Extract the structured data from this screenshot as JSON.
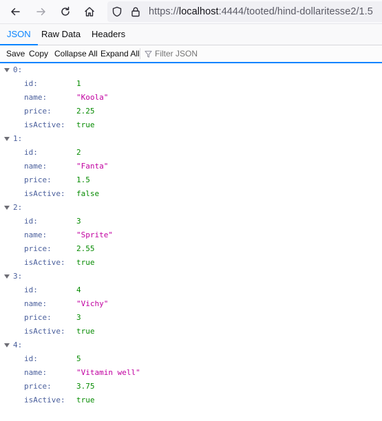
{
  "browser": {
    "url_prefix": "https://",
    "url_host": "localhost",
    "url_rest": ":4444/tooted/hind-dollaritesse2/1.5"
  },
  "tabs": [
    {
      "label": "JSON",
      "active": true
    },
    {
      "label": "Raw Data",
      "active": false
    },
    {
      "label": "Headers",
      "active": false
    }
  ],
  "toolbar": {
    "save": "Save",
    "copy": "Copy",
    "collapse_all": "Collapse All",
    "expand_all": "Expand All",
    "filter_placeholder": "Filter JSON"
  },
  "items": [
    {
      "index": "0:",
      "fields": [
        {
          "key": "id:",
          "value": "1",
          "type": "num"
        },
        {
          "key": "name:",
          "value": "\"Koola\"",
          "type": "str"
        },
        {
          "key": "price:",
          "value": "2.25",
          "type": "num"
        },
        {
          "key": "isActive:",
          "value": "true",
          "type": "bool"
        }
      ]
    },
    {
      "index": "1:",
      "fields": [
        {
          "key": "id:",
          "value": "2",
          "type": "num"
        },
        {
          "key": "name:",
          "value": "\"Fanta\"",
          "type": "str"
        },
        {
          "key": "price:",
          "value": "1.5",
          "type": "num"
        },
        {
          "key": "isActive:",
          "value": "false",
          "type": "bool"
        }
      ]
    },
    {
      "index": "2:",
      "fields": [
        {
          "key": "id:",
          "value": "3",
          "type": "num"
        },
        {
          "key": "name:",
          "value": "\"Sprite\"",
          "type": "str"
        },
        {
          "key": "price:",
          "value": "2.55",
          "type": "num"
        },
        {
          "key": "isActive:",
          "value": "true",
          "type": "bool"
        }
      ]
    },
    {
      "index": "3:",
      "fields": [
        {
          "key": "id:",
          "value": "4",
          "type": "num"
        },
        {
          "key": "name:",
          "value": "\"Vichy\"",
          "type": "str"
        },
        {
          "key": "price:",
          "value": "3",
          "type": "num"
        },
        {
          "key": "isActive:",
          "value": "true",
          "type": "bool"
        }
      ]
    },
    {
      "index": "4:",
      "fields": [
        {
          "key": "id:",
          "value": "5",
          "type": "num"
        },
        {
          "key": "name:",
          "value": "\"Vitamin well\"",
          "type": "str"
        },
        {
          "key": "price:",
          "value": "3.75",
          "type": "num"
        },
        {
          "key": "isActive:",
          "value": "true",
          "type": "bool"
        }
      ]
    }
  ]
}
